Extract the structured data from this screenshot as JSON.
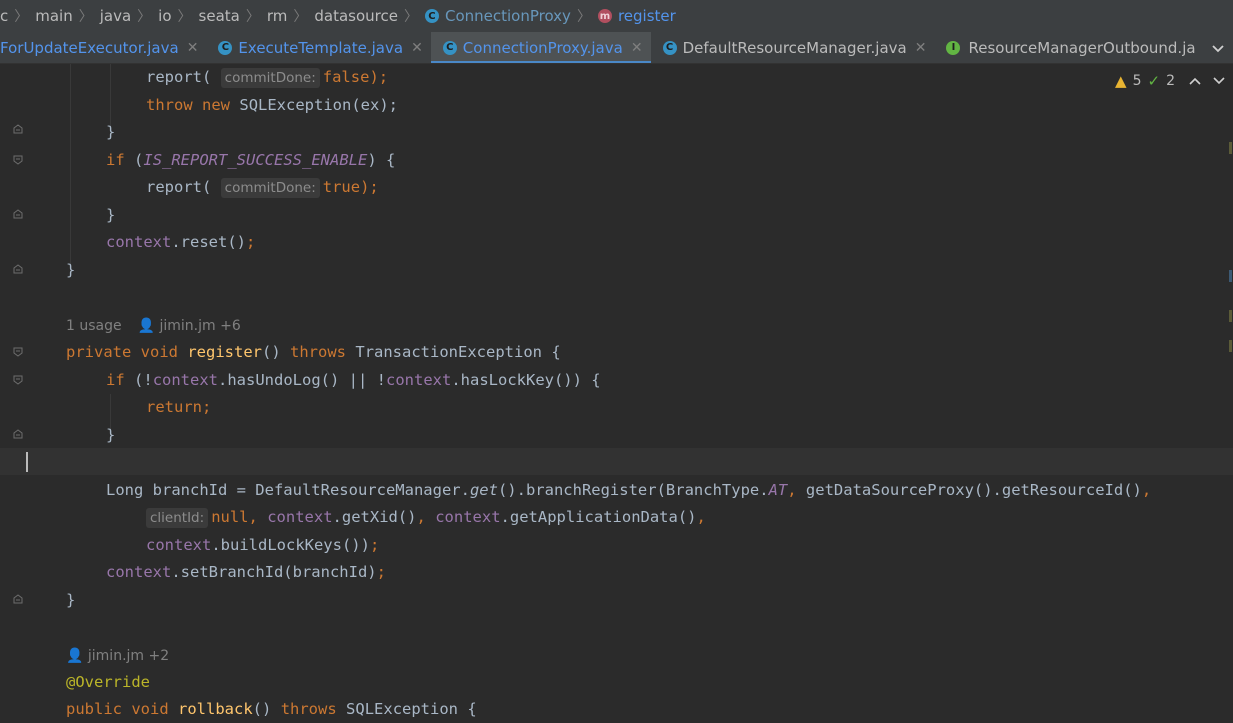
{
  "breadcrumb": {
    "items": [
      "c",
      "main",
      "java",
      "io",
      "seata",
      "rm",
      "datasource"
    ],
    "class_item": "ConnectionProxy",
    "method_item": "register"
  },
  "tabs": [
    {
      "label": "ForUpdateExecutor.java",
      "icon": "class-icon",
      "active": false
    },
    {
      "label": "ExecuteTemplate.java",
      "icon": "class-icon",
      "active": false
    },
    {
      "label": "ConnectionProxy.java",
      "icon": "class-icon",
      "active": true
    },
    {
      "label": "DefaultResourceManager.java",
      "icon": "class-icon",
      "active": false
    },
    {
      "label": "ResourceManagerOutbound.ja",
      "icon": "interface-icon",
      "active": false
    }
  ],
  "inspections": {
    "warnings": "5",
    "weak_warnings": "2"
  },
  "code": {
    "l1_a": "report(",
    "l1_hint": "commitDone:",
    "l1_b": "false",
    "l1_c": ");",
    "l2_a": "throw",
    "l2_b": "new",
    "l2_c": "SQLException(ex);",
    "l3": "}",
    "l4_a": "if",
    "l4_b": "(",
    "l4_c": "IS_REPORT_SUCCESS_ENABLE",
    "l4_d": ") {",
    "l5_a": "report(",
    "l5_hint": "commitDone:",
    "l5_b": "true",
    "l5_c": ");",
    "l6": "}",
    "l7_a": "context",
    "l7_b": ".reset()",
    "l7_c": ";",
    "l8": "}",
    "meta1_usage": "1 usage",
    "meta1_author": "jimin.jm +6",
    "l9_a": "private",
    "l9_b": "void",
    "l9_c": "register",
    "l9_d": "()",
    "l9_e": "throws",
    "l9_f": "TransactionException {",
    "l10_a": "if",
    "l10_b": "(!",
    "l10_c": "context",
    "l10_d": ".hasUndoLog() || !",
    "l10_e": "context",
    "l10_f": ".hasLockKey()) {",
    "l11": "return;",
    "l12": "}",
    "l13_a": "Long branchId = DefaultResourceManager.",
    "l13_b": "get",
    "l13_c": "().branchRegister(BranchType.",
    "l13_d": "AT",
    "l13_e": ",",
    "l13_f": " getDataSourceProxy().getResourceId()",
    "l13_g": ",",
    "l14_hint": "clientId:",
    "l14_a": "null",
    "l14_b": ",",
    "l14_c": "context",
    "l14_d": ".getXid()",
    "l14_e": ",",
    "l14_f": "context",
    "l14_g": ".getApplicationData()",
    "l14_h": ",",
    "l15_a": "context",
    "l15_b": ".buildLockKeys())",
    "l15_c": ";",
    "l16_a": "context",
    "l16_b": ".setBranchId(branchId)",
    "l16_c": ";",
    "l17": "}",
    "meta2_author": "jimin.jm +2",
    "l18": "@Override",
    "l19_a": "public",
    "l19_b": "void",
    "l19_c": "rollback",
    "l19_d": "()",
    "l19_e": "throws",
    "l19_f": "SQLException {"
  }
}
